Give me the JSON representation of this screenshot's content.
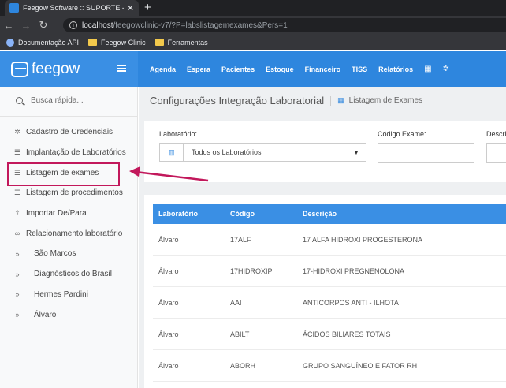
{
  "browser": {
    "tab_title": "Feegow Software :: SUPORTE - M",
    "url_host": "localhost",
    "url_path": "/feegowclinic-v7/?P=labslistagemexames&Pers=1",
    "bookmarks": [
      "Documentação API",
      "Feegow Clinic",
      "Ferramentas"
    ]
  },
  "header": {
    "logo": "feegow",
    "nav": [
      "Agenda",
      "Espera",
      "Pacientes",
      "Estoque",
      "Financeiro",
      "TISS",
      "Relatórios"
    ]
  },
  "sidebar": {
    "search_placeholder": "Busca rápida...",
    "items": [
      {
        "label": "Cadastro de Credenciais",
        "icon": "gear-icon"
      },
      {
        "label": "Implantação de Laboratórios",
        "icon": "list-icon"
      },
      {
        "label": "Listagem de exames",
        "icon": "list-icon"
      },
      {
        "label": "Listagem de procedimentos",
        "icon": "list-icon"
      },
      {
        "label": "Importar De/Para",
        "icon": "upload-icon"
      },
      {
        "label": "Relacionamento laboratório",
        "icon": "link-icon"
      },
      {
        "label": "São Marcos",
        "icon": "chevron-right-icon"
      },
      {
        "label": "Diagnósticos do Brasil",
        "icon": "chevron-right-icon"
      },
      {
        "label": "Hermes Pardini",
        "icon": "chevron-right-icon"
      },
      {
        "label": "Álvaro",
        "icon": "chevron-right-icon"
      }
    ]
  },
  "main": {
    "title": "Configurações Integração Laboratorial",
    "subtitle": "Listagem de Exames",
    "filters": {
      "lab_label": "Laboratório:",
      "lab_value": "Todos os Laboratórios",
      "code_label": "Código Exame:",
      "desc_label": "Descri"
    },
    "table": {
      "headers": [
        "Laboratório",
        "Código",
        "Descrição"
      ],
      "rows": [
        [
          "Álvaro",
          "17ALF",
          "17 ALFA HIDROXI PROGESTERONA"
        ],
        [
          "Álvaro",
          "17HIDROXIP",
          "17-HIDROXI PREGNENOLONA"
        ],
        [
          "Álvaro",
          "AAI",
          "ANTICORPOS ANTI - ILHOTA"
        ],
        [
          "Álvaro",
          "ABILT",
          "ÁCIDOS BILIARES TOTAIS"
        ],
        [
          "Álvaro",
          "ABORH",
          "GRUPO SANGUÍNEO E FATOR RH"
        ]
      ]
    }
  },
  "colors": {
    "brand": "#2e86de",
    "annotation": "#c2185b"
  }
}
